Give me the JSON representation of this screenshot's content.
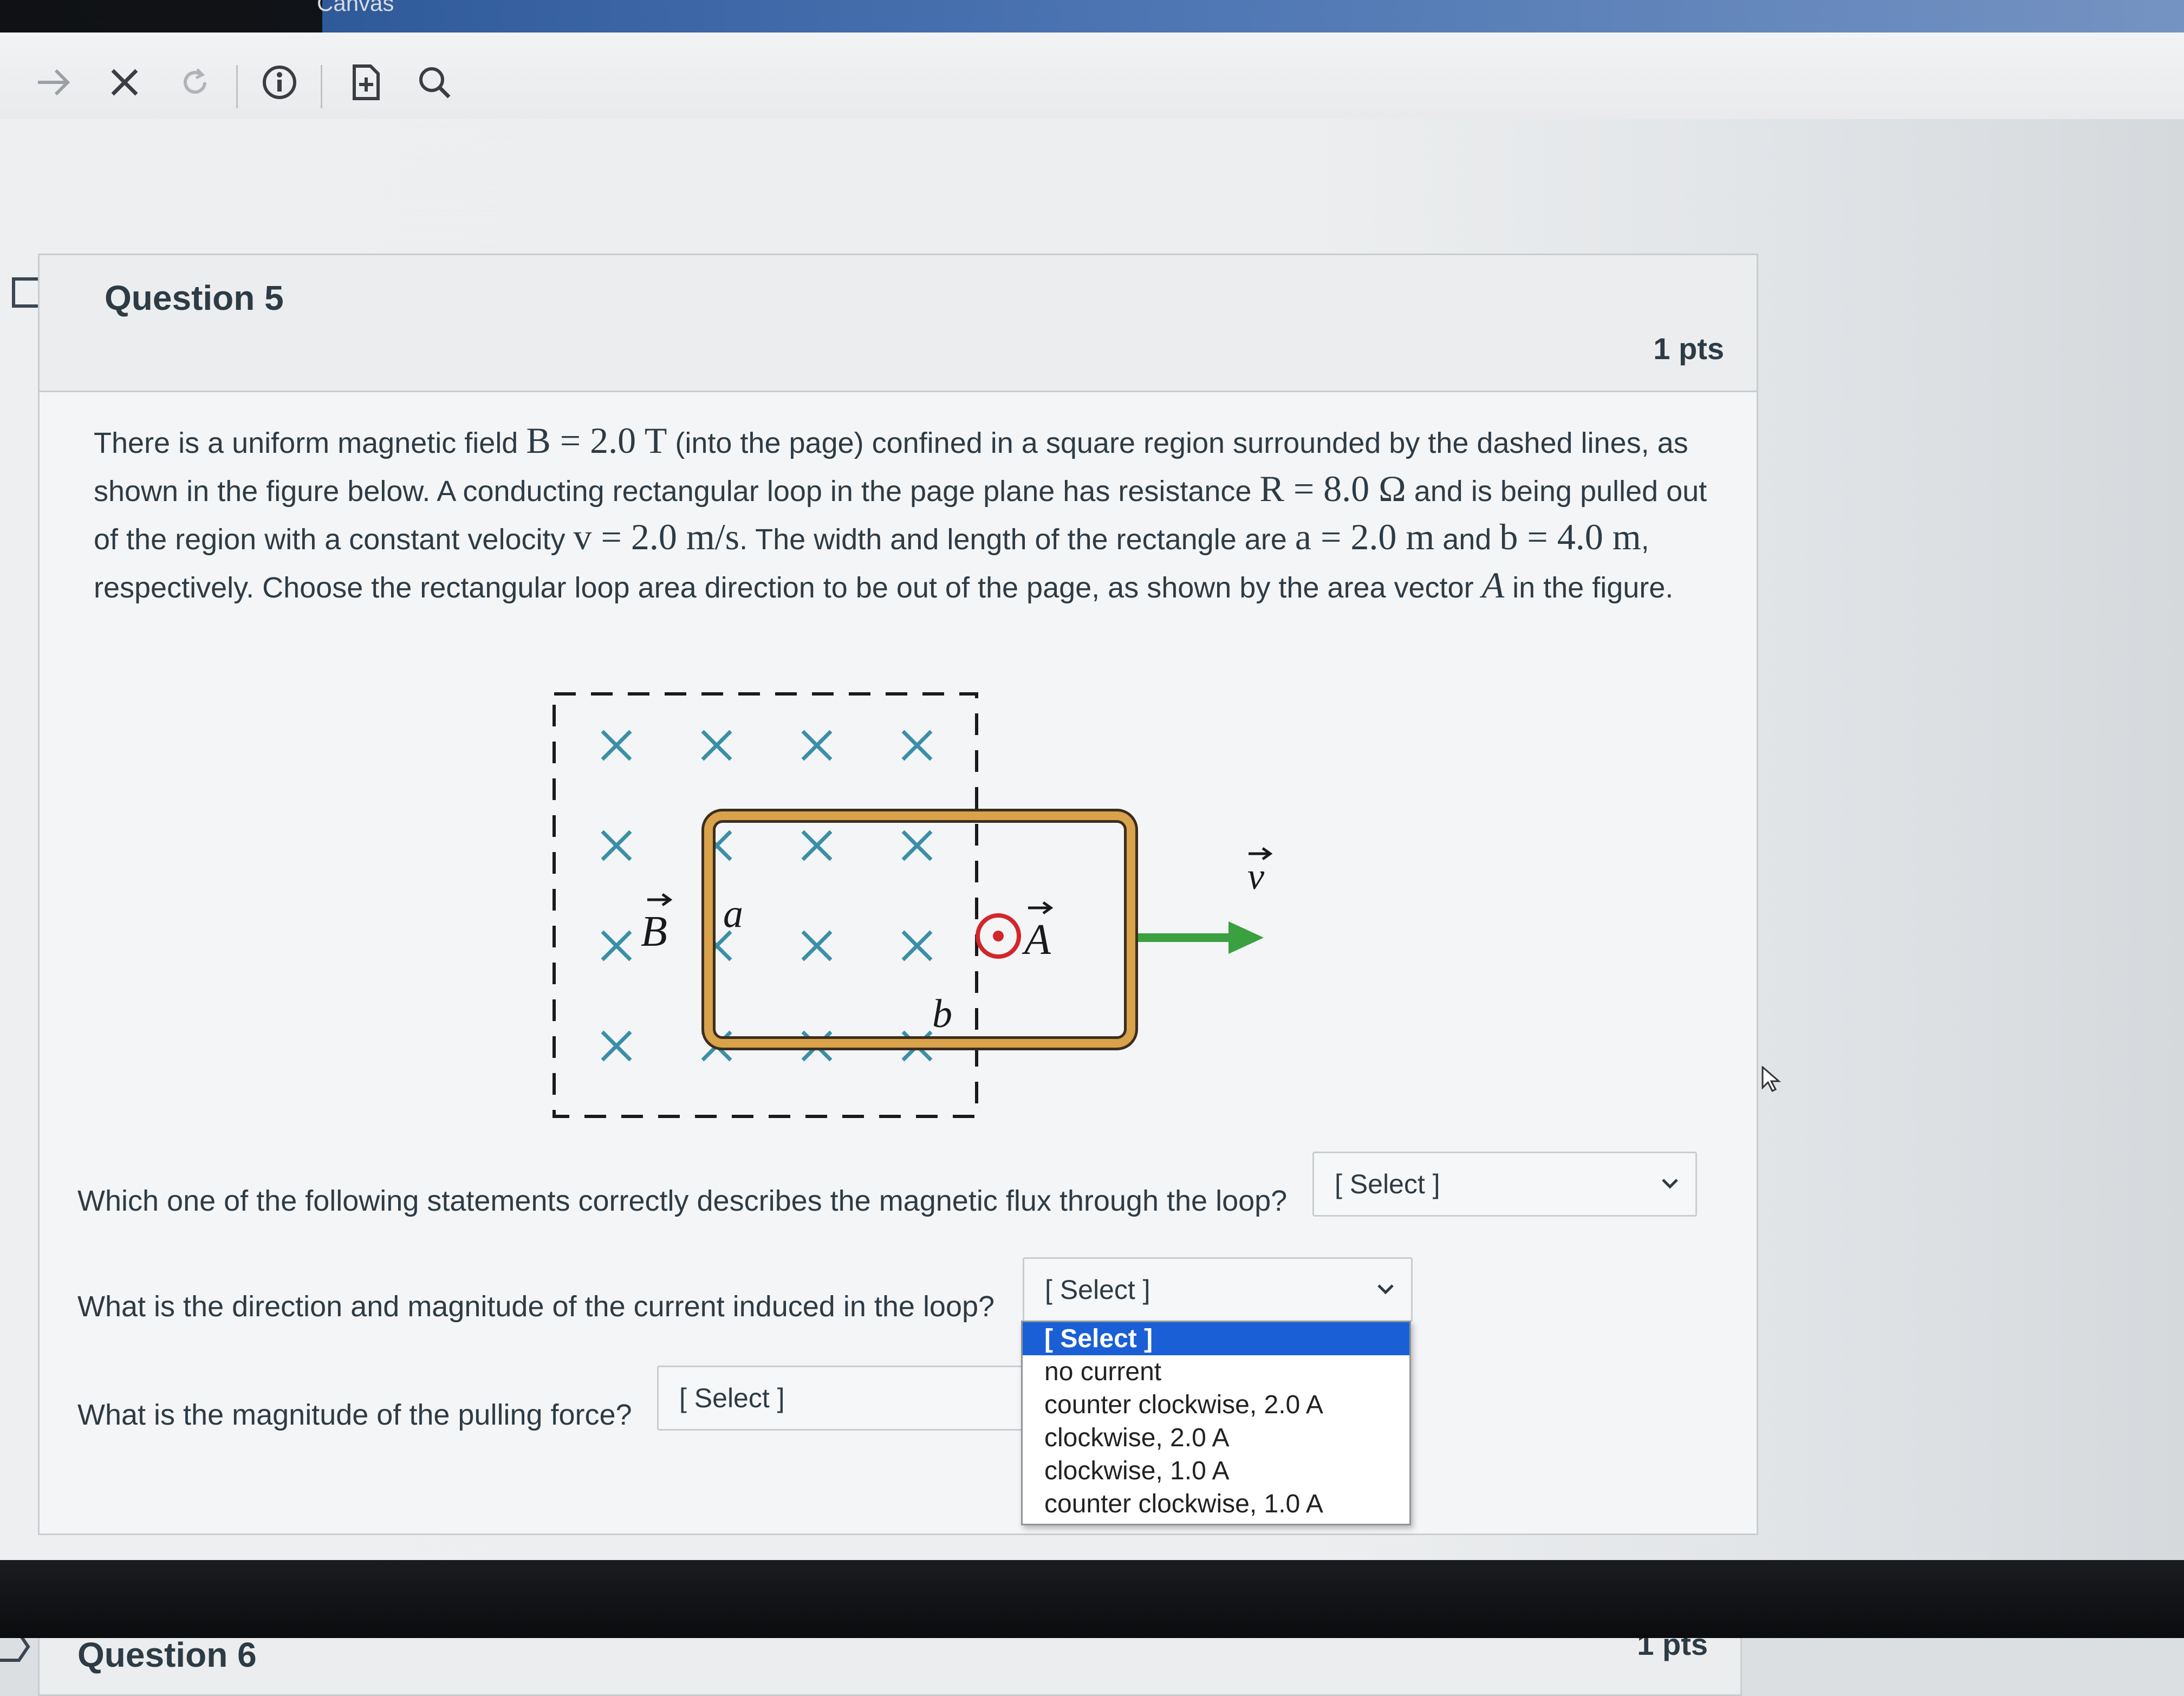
{
  "browser": {
    "tab_label": "Canvas",
    "toolbar_icons": [
      "forward-arrow-icon",
      "close-icon",
      "reload-icon",
      "info-icon",
      "add-page-icon",
      "search-icon"
    ]
  },
  "question5": {
    "title": "Question 5",
    "points": "1 pts",
    "text": {
      "p1": "There is a uniform magnetic field ",
      "B_eq": "B = 2.0 T",
      "p2": " (into the page) confined in a square region surrounded by the dashed lines, as shown in the figure below. A conducting rectangular loop in the page plane has resistance ",
      "R_eq": "R = 8.0 Ω",
      "p3": " and is being pulled out of the region with a constant velocity ",
      "v_eq": "v = 2.0 m/s",
      "p4": ". The width and length of the rectangle are ",
      "a_eq": "a = 2.0 m",
      "p5": " and ",
      "b_eq": "b = 4.0 m",
      "p6": ", respectively. Choose the rectangular loop area direction to be out of the page, as shown by the area vector ",
      "A_vec": "A",
      "p7": " in the figure."
    },
    "figure": {
      "label_B": "B",
      "label_a": "a",
      "label_b": "b",
      "label_A": "A",
      "label_v": "v",
      "colors": {
        "cross": "#3a8fa8",
        "loop": "#d9a24b",
        "arrow": "#3aa040",
        "area_vector": "#d3262b"
      }
    },
    "sub1": {
      "prompt": "Which one of the following statements correctly describes the magnetic flux through the loop?",
      "selected": "[ Select ]"
    },
    "sub2": {
      "prompt": "What is the direction and magnitude of the current induced in the loop?",
      "selected": "[ Select ]"
    },
    "sub3": {
      "prompt": "What is the magnitude of the pulling force?",
      "selected": "[ Select ]"
    },
    "dropdown_options": [
      "[ Select ]",
      "no current",
      "counter clockwise, 2.0 A",
      "clockwise, 2.0 A",
      "clockwise, 1.0 A",
      "counter clockwise, 1.0 A"
    ]
  },
  "question6": {
    "title": "Question 6",
    "points": "1 pts"
  }
}
